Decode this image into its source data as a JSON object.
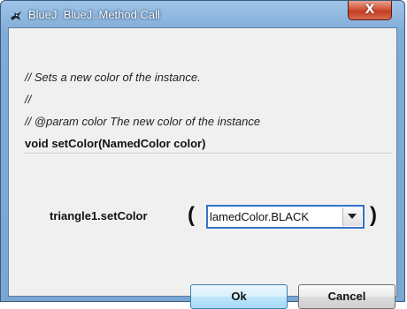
{
  "window": {
    "title": "BlueJ:  BlueJ:  Method Call",
    "close_label": "X"
  },
  "doc": {
    "comment_lines": [
      "// Sets a new color of the instance.",
      "//",
      "// @param color The new color of the instance"
    ],
    "signature": "void setColor(NamedColor color)"
  },
  "call": {
    "method": "triangle1.setColor",
    "open_paren": "(",
    "close_paren": ")",
    "selected_value": "lamedColor.BLACK"
  },
  "buttons": {
    "ok_label": "Ok",
    "cancel_label": "Cancel"
  },
  "icons": {
    "app": "bluej-bird-icon",
    "close": "close-icon",
    "dropdown": "chevron-down-icon"
  },
  "colors": {
    "frame": "#7fabd6",
    "close_button": "#c33f24",
    "focus_border": "#3373c8",
    "ok_button": "#bee6fd"
  }
}
